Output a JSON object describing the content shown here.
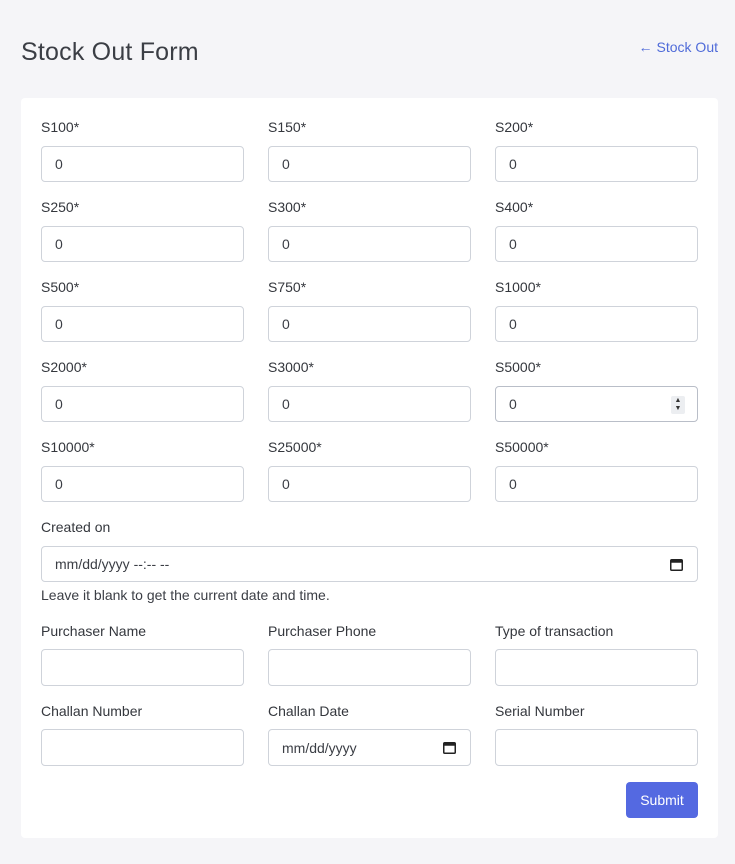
{
  "header": {
    "title": "Stock Out Form",
    "back_link": "Stock Out"
  },
  "denominations": [
    {
      "label": "S100*",
      "value": "0"
    },
    {
      "label": "S150*",
      "value": "0"
    },
    {
      "label": "S200*",
      "value": "0"
    },
    {
      "label": "S250*",
      "value": "0"
    },
    {
      "label": "S300*",
      "value": "0"
    },
    {
      "label": "S400*",
      "value": "0"
    },
    {
      "label": "S500*",
      "value": "0"
    },
    {
      "label": "S750*",
      "value": "0"
    },
    {
      "label": "S1000*",
      "value": "0"
    },
    {
      "label": "S2000*",
      "value": "0"
    },
    {
      "label": "S3000*",
      "value": "0"
    },
    {
      "label": "S5000*",
      "value": "0"
    },
    {
      "label": "S10000*",
      "value": "0"
    },
    {
      "label": "S25000*",
      "value": "0"
    },
    {
      "label": "S50000*",
      "value": "0"
    }
  ],
  "created_on": {
    "label": "Created on",
    "placeholder": "mm/dd/yyyy --:-- --",
    "help": "Leave it blank to get the current date and time."
  },
  "details": [
    {
      "label": "Purchaser Name",
      "value": ""
    },
    {
      "label": "Purchaser Phone",
      "value": ""
    },
    {
      "label": "Type of transaction",
      "value": ""
    },
    {
      "label": "Challan Number",
      "value": ""
    },
    {
      "label": "Challan Date",
      "value": "mm/dd/yyyy"
    },
    {
      "label": "Serial Number",
      "value": ""
    }
  ],
  "submit_label": "Submit",
  "colors": {
    "accent": "#5469e1",
    "link": "#4f6bd9",
    "background": "#f5f5f8"
  }
}
